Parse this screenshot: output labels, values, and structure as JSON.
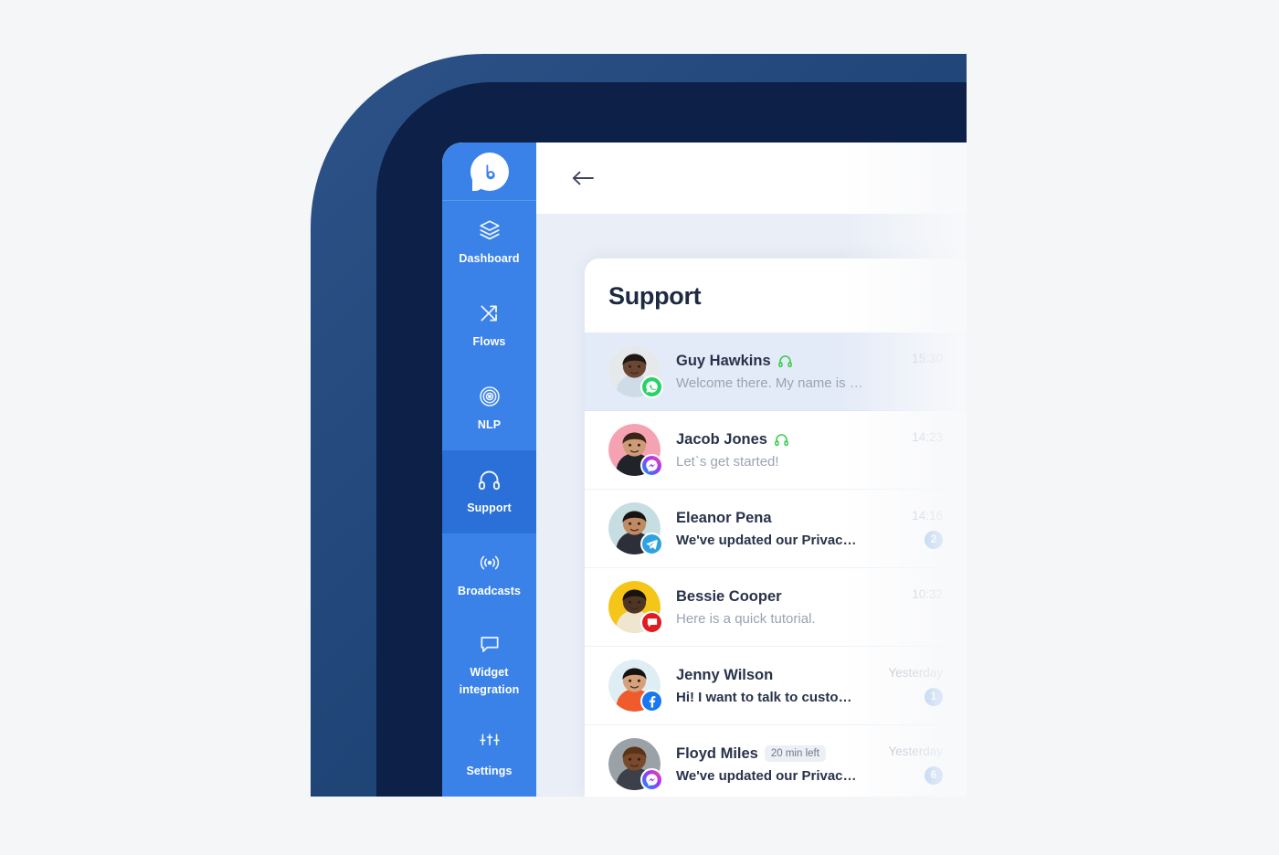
{
  "theme": {
    "page_bg": "#f4f6f8",
    "frame_outer": "#1f4476",
    "frame_bezel": "#0d2048",
    "sidebar_bg": "#3b82e8",
    "sidebar_active_bg": "#2a70d8",
    "accent": "#4a90e2",
    "active_row_bg": "#e4ebf8",
    "headphones_green": "#2ecc40"
  },
  "sidebar": {
    "brand": {
      "icon": "botty-logo-icon",
      "letter": "b"
    },
    "items": [
      {
        "id": "dashboard",
        "label": "Dashboard",
        "icon": "layers-icon",
        "active": false
      },
      {
        "id": "flows",
        "label": "Flows",
        "icon": "shuffle-arrows-icon",
        "active": false
      },
      {
        "id": "nlp",
        "label": "NLP",
        "icon": "target-rings-icon",
        "active": false
      },
      {
        "id": "support",
        "label": "Support",
        "icon": "headphones-icon",
        "active": true
      },
      {
        "id": "broadcasts",
        "label": "Broadcasts",
        "icon": "broadcast-waves-icon",
        "active": false
      },
      {
        "id": "widget-integration",
        "label": "Widget integration",
        "icon": "speech-bubble-icon",
        "active": false
      },
      {
        "id": "settings",
        "label": "Settings",
        "icon": "sliders-icon",
        "active": false
      }
    ]
  },
  "topbar": {
    "back_icon": "arrow-left-icon"
  },
  "main": {
    "title": "Support"
  },
  "chats": [
    {
      "name": "Guy Hawkins",
      "agent_icon": "headphones-icon",
      "has_agent": true,
      "preview": "Welcome there. My name is Botty...",
      "time": "15:30",
      "unread": "",
      "channel": "whatsapp",
      "active": true,
      "bold_preview": false,
      "timer": ""
    },
    {
      "name": "Jacob Jones",
      "agent_icon": "headphones-icon",
      "has_agent": true,
      "preview": "Let`s get started!",
      "time": "14:23",
      "unread": "",
      "channel": "messenger",
      "active": false,
      "bold_preview": false,
      "timer": ""
    },
    {
      "name": "Eleanor Pena",
      "agent_icon": "",
      "has_agent": false,
      "preview": "We've updated our Privacy Pol...",
      "time": "14:16",
      "unread": "2",
      "channel": "telegram",
      "active": false,
      "bold_preview": true,
      "timer": ""
    },
    {
      "name": "Bessie Cooper",
      "agent_icon": "",
      "has_agent": false,
      "preview": "Here is a quick tutorial.",
      "time": "10:32",
      "unread": "",
      "channel": "webchat",
      "active": false,
      "bold_preview": false,
      "timer": ""
    },
    {
      "name": "Jenny Wilson",
      "agent_icon": "",
      "has_agent": false,
      "preview": "Hi! I want to talk to customer su...",
      "time": "Yesterday",
      "unread": "1",
      "channel": "facebook",
      "active": false,
      "bold_preview": true,
      "timer": ""
    },
    {
      "name": "Floyd Miles",
      "agent_icon": "",
      "has_agent": false,
      "preview": "We've updated our Privacy Pol...",
      "time": "Yesterday",
      "unread": "6",
      "channel": "messenger",
      "active": false,
      "bold_preview": true,
      "timer": "20 min left"
    }
  ]
}
